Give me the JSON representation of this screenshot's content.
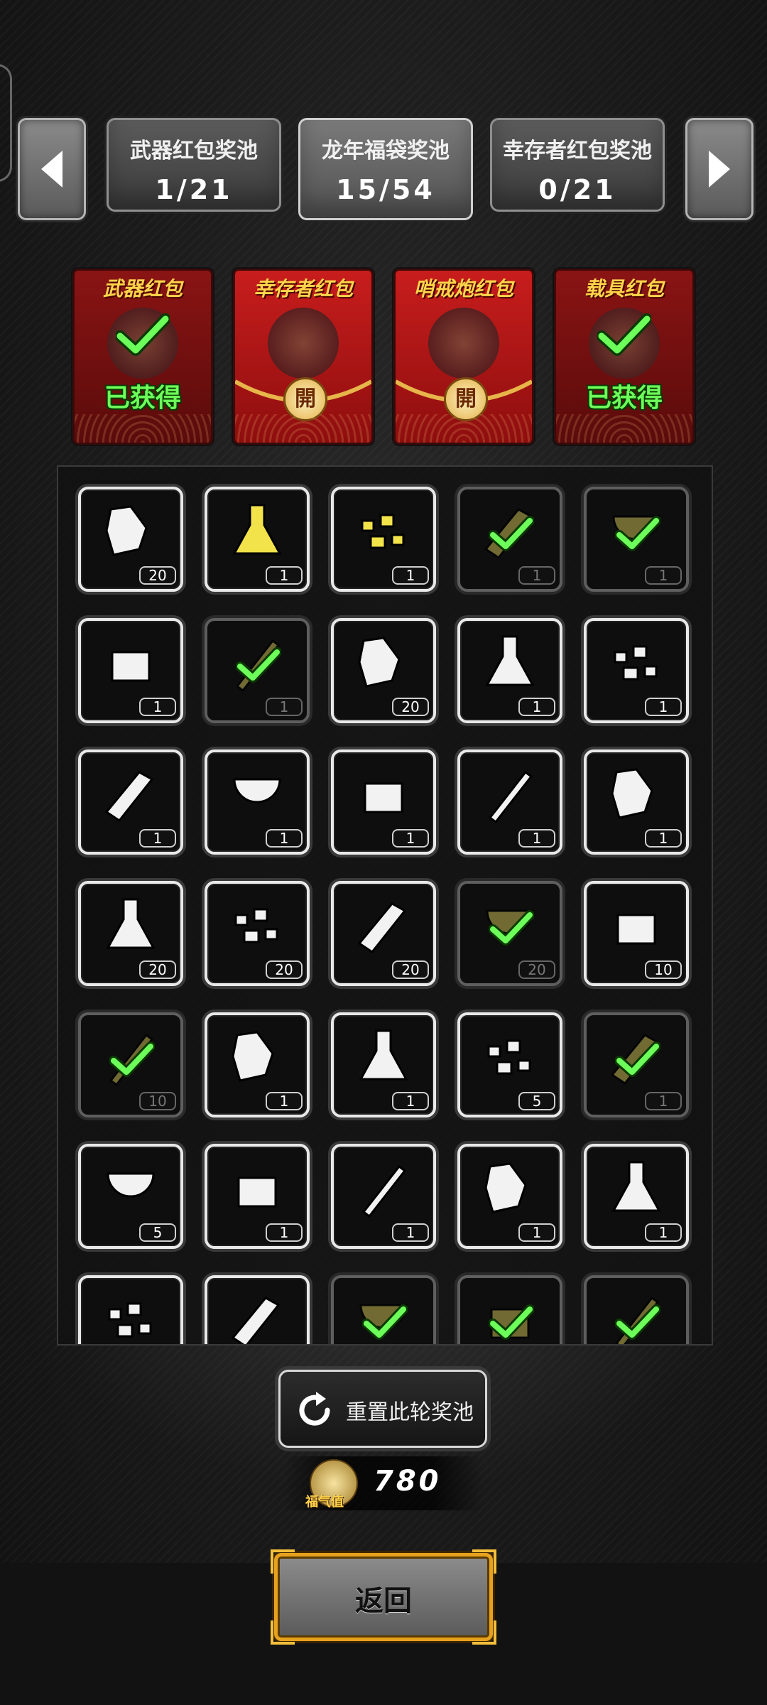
{
  "colors": {
    "accent_green": "#6dff5a",
    "envelope_red": "#c81d1d",
    "gold": "#e6a21e"
  },
  "nav": {
    "left_icon": "arrow-left-icon",
    "right_icon": "arrow-right-icon"
  },
  "tabs": [
    {
      "label": "武器红包奖池",
      "count": "1/21",
      "active": false
    },
    {
      "label": "龙年福袋奖池",
      "count": "15/54",
      "active": true
    },
    {
      "label": "幸存者红包奖池",
      "count": "0/21",
      "active": false
    }
  ],
  "envelopes": [
    {
      "title": "武器红包",
      "status": "已获得",
      "obtained": true
    },
    {
      "title": "幸存者红包",
      "seal": "開",
      "obtained": false
    },
    {
      "title": "哨戒炮红包",
      "seal": "開",
      "obtained": false
    },
    {
      "title": "载具红包",
      "status": "已获得",
      "obtained": true
    }
  ],
  "items": [
    {
      "icon": "toothpaste-icon",
      "qty": "20",
      "got": false
    },
    {
      "icon": "flask-icon",
      "qty": "1",
      "got": false
    },
    {
      "icon": "gold-nuggets-icon",
      "qty": "1",
      "got": false
    },
    {
      "icon": "wood-planks-icon",
      "qty": "1",
      "got": true
    },
    {
      "icon": "scrap-parts-icon",
      "qty": "1",
      "got": true
    },
    {
      "icon": "cloth-icon",
      "qty": "1",
      "got": false
    },
    {
      "icon": "sticks-icon",
      "qty": "1",
      "got": true
    },
    {
      "icon": "silver-bar-icon",
      "qty": "20",
      "got": false
    },
    {
      "icon": "gold-bars-icon",
      "qty": "1",
      "got": false
    },
    {
      "icon": "vase-icon",
      "qty": "1",
      "got": false
    },
    {
      "icon": "ring-icon",
      "qty": "1",
      "got": false
    },
    {
      "icon": "food-bowl-icon",
      "qty": "1",
      "got": false
    },
    {
      "icon": "coffee-cup-icon",
      "qty": "1",
      "got": false
    },
    {
      "icon": "stew-bowl-icon",
      "qty": "1",
      "got": false
    },
    {
      "icon": "tools-bag-icon",
      "qty": "1",
      "got": false
    },
    {
      "icon": "battery-icon",
      "qty": "20",
      "got": false
    },
    {
      "icon": "bullet-icon",
      "qty": "20",
      "got": false
    },
    {
      "icon": "fuel-barrel-icon",
      "qty": "20",
      "got": false
    },
    {
      "icon": "rifle-round-icon",
      "qty": "20",
      "got": true
    },
    {
      "icon": "pen-icon",
      "qty": "10",
      "got": false
    },
    {
      "icon": "spray-can-icon",
      "qty": "10",
      "got": true
    },
    {
      "icon": "drink-cup-icon",
      "qty": "1",
      "got": false
    },
    {
      "icon": "jar-icon",
      "qty": "1",
      "got": false
    },
    {
      "icon": "globe-net-icon",
      "qty": "5",
      "got": false
    },
    {
      "icon": "juice-cup-icon",
      "qty": "1",
      "got": true
    },
    {
      "icon": "net-icon",
      "qty": "5",
      "got": false
    },
    {
      "icon": "skewers-icon",
      "qty": "1",
      "got": false
    },
    {
      "icon": "sandwich-stack-icon",
      "qty": "1",
      "got": false
    },
    {
      "icon": "bread-icon",
      "qty": "1",
      "got": false
    },
    {
      "icon": "bottle-icon",
      "qty": "1",
      "got": false
    },
    {
      "icon": "boot-icon",
      "qty": "",
      "got": false
    },
    {
      "icon": "potatoes-icon",
      "qty": "",
      "got": false
    },
    {
      "icon": "grenade-launcher-icon",
      "qty": "",
      "got": true
    },
    {
      "icon": "rock-pile-icon",
      "qty": "",
      "got": true
    },
    {
      "icon": "helmet-icon",
      "qty": "",
      "got": true
    }
  ],
  "reset": {
    "icon": "refresh-icon",
    "label": "重置此轮奖池"
  },
  "lucky": {
    "icon": "lucky-coin-icon",
    "label": "福气值",
    "value": "780"
  },
  "back": {
    "label": "返回"
  }
}
